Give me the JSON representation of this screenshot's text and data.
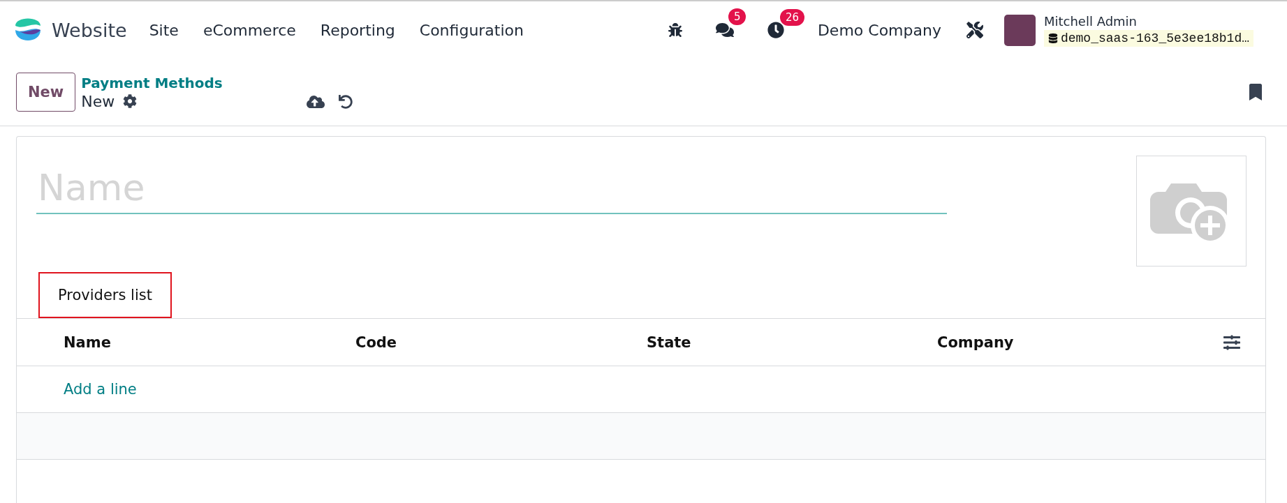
{
  "navbar": {
    "app_name": "Website",
    "menus": [
      "Site",
      "eCommerce",
      "Reporting",
      "Configuration"
    ],
    "messages_count": "5",
    "activities_count": "26",
    "company": "Demo Company",
    "user": {
      "name": "Mitchell Admin",
      "database": "demo_saas-163_5e3ee18b1d…"
    }
  },
  "control_panel": {
    "new_button": "New",
    "breadcrumb": "Payment Methods",
    "record": "New"
  },
  "form": {
    "name_placeholder": "Name",
    "tabs": [
      {
        "label": "Providers list",
        "selected": true
      }
    ],
    "table": {
      "columns": [
        "Name",
        "Code",
        "State",
        "Company"
      ],
      "add_line": "Add a line"
    }
  }
}
